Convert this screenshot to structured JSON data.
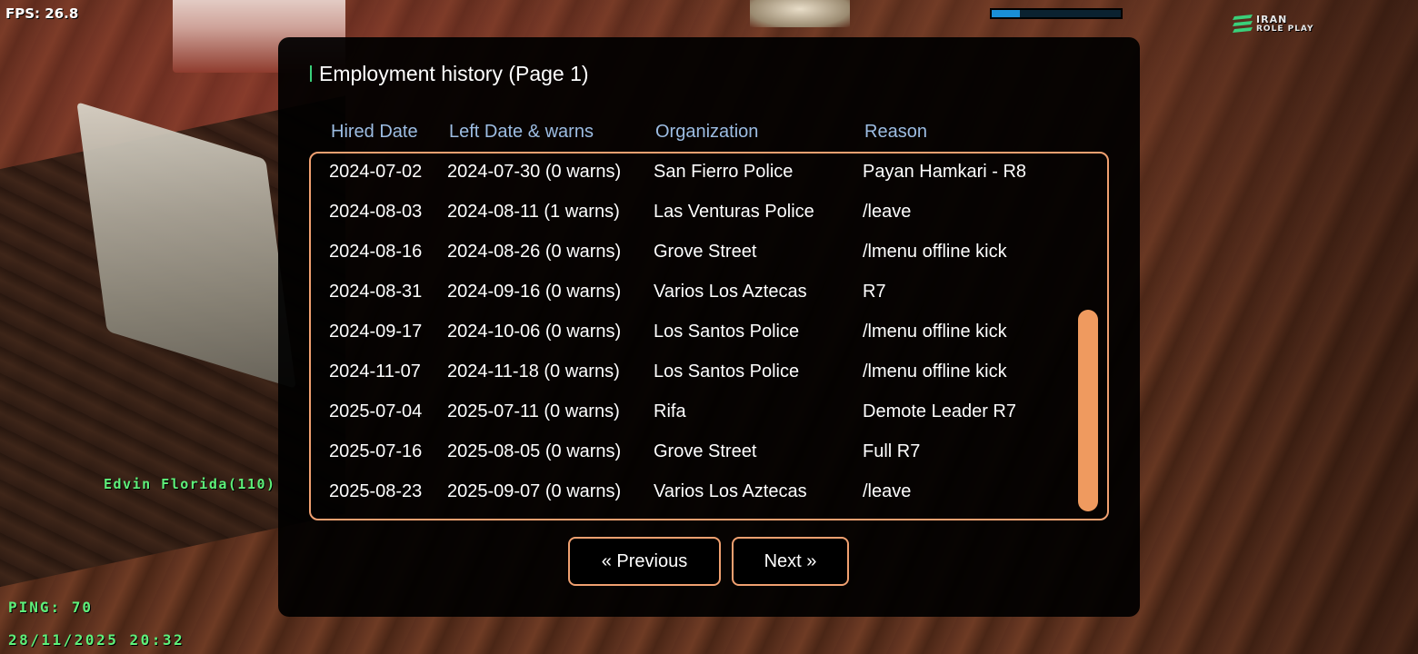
{
  "hud": {
    "fps": "FPS: 26.8",
    "ping": "PING: 70",
    "datetime": "28/11/2025 20:32",
    "player_name": "Edvin Florida(110)",
    "health_bar_fraction": 0.22,
    "health_bar_color": "#1a8fd6"
  },
  "logo": {
    "line1": "IRAN",
    "line2": "ROLE PLAY",
    "icon": "iran-roleplay-logo-icon"
  },
  "dialog": {
    "title": "Employment history (Page 1)",
    "columns": {
      "hired": "Hired Date",
      "left": "Left Date & warns",
      "org": "Organization",
      "reason": "Reason"
    },
    "rows": [
      {
        "hired": "2024-07-02",
        "left": "2024-07-30 (0 warns)",
        "org": "San Fierro Police",
        "reason": "Payan Hamkari - R8"
      },
      {
        "hired": "2024-08-03",
        "left": "2024-08-11 (1 warns)",
        "org": "Las Venturas Police",
        "reason": "/leave"
      },
      {
        "hired": "2024-08-16",
        "left": "2024-08-26 (0 warns)",
        "org": "Grove Street",
        "reason": "/lmenu offline kick"
      },
      {
        "hired": "2024-08-31",
        "left": "2024-09-16 (0 warns)",
        "org": "Varios Los Aztecas",
        "reason": "R7"
      },
      {
        "hired": "2024-09-17",
        "left": "2024-10-06 (0 warns)",
        "org": "Los Santos Police",
        "reason": "/lmenu offline kick"
      },
      {
        "hired": "2024-11-07",
        "left": "2024-11-18 (0 warns)",
        "org": "Los Santos Police",
        "reason": "/lmenu offline kick"
      },
      {
        "hired": "2025-07-04",
        "left": "2025-07-11 (0 warns)",
        "org": "Rifa",
        "reason": "Demote Leader R7"
      },
      {
        "hired": "2025-07-16",
        "left": "2025-08-05 (0 warns)",
        "org": "Grove Street",
        "reason": "Full R7"
      },
      {
        "hired": "2025-08-23",
        "left": "2025-09-07 (0 warns)",
        "org": "Varios Los Aztecas",
        "reason": "/leave"
      }
    ],
    "prev_label": "« Previous",
    "next_label": "Next »",
    "accent_color": "#f0a070",
    "header_color": "#9dbde3"
  }
}
